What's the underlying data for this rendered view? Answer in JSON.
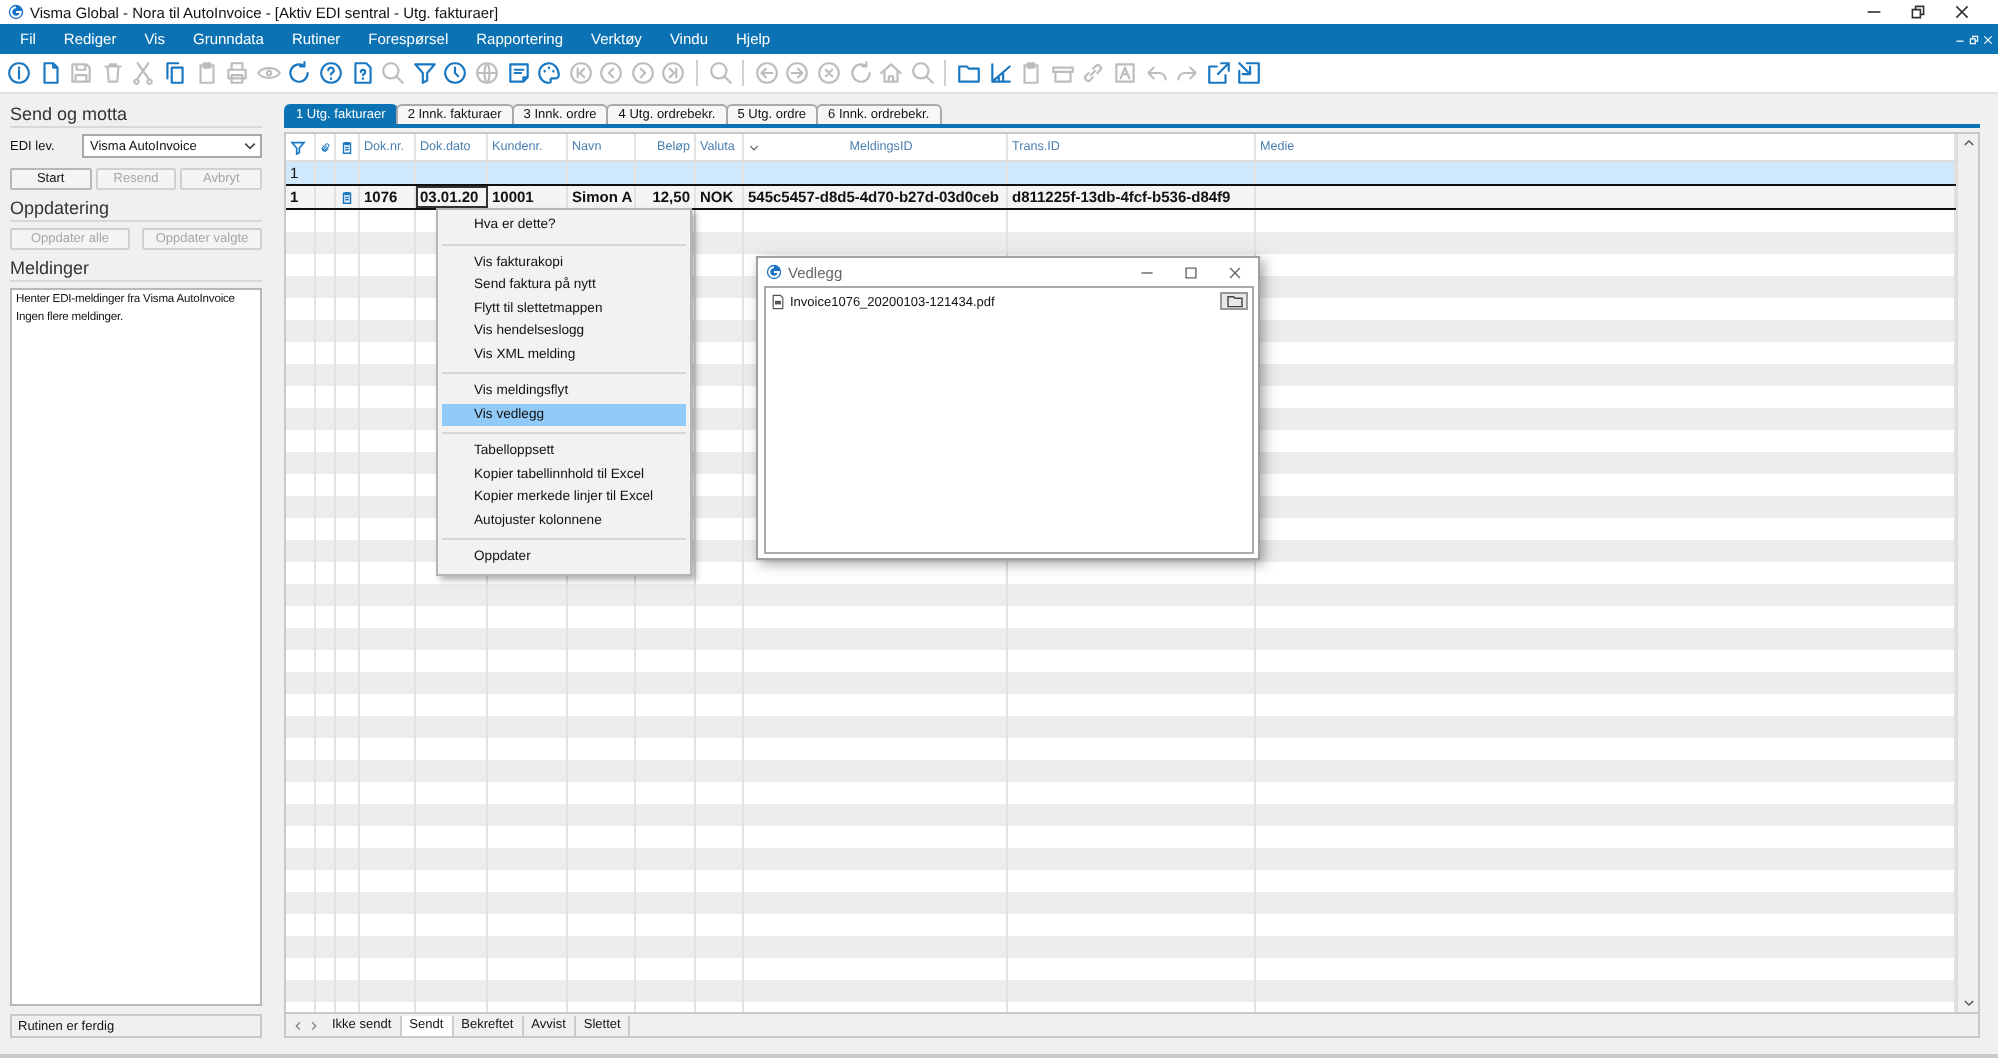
{
  "window": {
    "title": "Visma Global - Nora til AutoInvoice - [Aktiv EDI sentral - Utg. fakturaer]"
  },
  "menu": [
    "Fil",
    "Rediger",
    "Vis",
    "Grunndata",
    "Rutiner",
    "Forespørsel",
    "Rapportering",
    "Verktøy",
    "Vindu",
    "Hjelp"
  ],
  "toolbar": [
    {
      "kind": "info",
      "disabled": false
    },
    {
      "kind": "new",
      "disabled": false
    },
    {
      "kind": "save",
      "disabled": true
    },
    {
      "kind": "delete",
      "disabled": true
    },
    {
      "kind": "cut",
      "disabled": true
    },
    {
      "kind": "copy",
      "disabled": false
    },
    {
      "kind": "paste",
      "disabled": true
    },
    {
      "kind": "print",
      "disabled": true
    },
    {
      "kind": "eye",
      "disabled": true
    },
    {
      "kind": "refresh",
      "disabled": false
    },
    {
      "kind": "help",
      "disabled": false
    },
    {
      "kind": "dochelp",
      "disabled": false
    },
    {
      "kind": "search",
      "disabled": true
    },
    {
      "kind": "filter",
      "disabled": false
    },
    {
      "kind": "clock",
      "disabled": false
    },
    {
      "kind": "globe",
      "disabled": true
    },
    {
      "kind": "note",
      "disabled": false
    },
    {
      "kind": "palette",
      "disabled": false
    },
    {
      "kind": "first",
      "disabled": true
    },
    {
      "kind": "prev",
      "disabled": true
    },
    {
      "kind": "next",
      "disabled": true
    },
    {
      "kind": "last",
      "disabled": true
    },
    {
      "kind": "separator"
    },
    {
      "kind": "search",
      "disabled": true
    },
    {
      "kind": "separator"
    },
    {
      "kind": "back",
      "disabled": true
    },
    {
      "kind": "forward",
      "disabled": true
    },
    {
      "kind": "cancel",
      "disabled": true
    },
    {
      "kind": "refresh",
      "disabled": true
    },
    {
      "kind": "home",
      "disabled": true
    },
    {
      "kind": "search",
      "disabled": true
    },
    {
      "kind": "separator"
    },
    {
      "kind": "folder",
      "disabled": false
    },
    {
      "kind": "chart",
      "disabled": false
    },
    {
      "kind": "paste",
      "disabled": true
    },
    {
      "kind": "box",
      "disabled": true
    },
    {
      "kind": "link",
      "disabled": true
    },
    {
      "kind": "textbox",
      "disabled": true
    },
    {
      "kind": "undo",
      "disabled": true
    },
    {
      "kind": "redo",
      "disabled": true
    },
    {
      "kind": "export",
      "disabled": false
    },
    {
      "kind": "import",
      "disabled": false
    }
  ],
  "left_panel": {
    "send_title": "Send og motta",
    "edi_label": "EDI lev.",
    "edi_value": "Visma AutoInvoice",
    "send_buttons": [
      {
        "label": "Start",
        "disabled": false
      },
      {
        "label": "Resend",
        "disabled": true
      },
      {
        "label": "Avbryt",
        "disabled": true
      }
    ],
    "update_title": "Oppdatering",
    "update_buttons": [
      {
        "label": "Oppdater alle",
        "disabled": true
      },
      {
        "label": "Oppdater valgte",
        "disabled": true
      }
    ],
    "messages_title": "Meldinger",
    "messages": [
      "Henter EDI-meldinger fra Visma AutoInvoice",
      "Ingen flere meldinger."
    ],
    "status": "Rutinen er ferdig"
  },
  "tabs": [
    {
      "label": "1 Utg. fakturaer",
      "selected": true
    },
    {
      "label": "2 Innk. fakturaer",
      "selected": false
    },
    {
      "label": "3 Innk. ordre",
      "selected": false
    },
    {
      "label": "4 Utg. ordrebekr.",
      "selected": false
    },
    {
      "label": "5 Utg. ordre",
      "selected": false
    },
    {
      "label": "6 Innk. ordrebekr.",
      "selected": false
    }
  ],
  "table": {
    "columns": [
      "Dok.nr.",
      "Dok.dato",
      "Kundenr.",
      "Navn",
      "Beløp",
      "Valuta",
      "MeldingsID",
      "Trans.ID",
      "Medie"
    ],
    "rows": [
      {
        "number": "1",
        "selected": true,
        "current": false,
        "document": false
      },
      {
        "number": "1",
        "selected": false,
        "current": true,
        "document": true,
        "cells": [
          "1076",
          "03.01.20",
          "10001",
          "Simon A",
          "12,50",
          "NOK",
          "545c5457-d8d5-4d70-b27d-03d0ceb",
          "d811225f-13db-4fcf-b536-d84f9"
        ]
      }
    ]
  },
  "context_menu": [
    {
      "kind": "item",
      "label": "Hva er dette?",
      "selected": false
    },
    {
      "kind": "separator"
    },
    {
      "kind": "item",
      "label": "Vis fakturakopi",
      "selected": false
    },
    {
      "kind": "item",
      "label": "Send faktura på nytt",
      "selected": false
    },
    {
      "kind": "item",
      "label": "Flytt til slettetmappen",
      "selected": false
    },
    {
      "kind": "item",
      "label": "Vis hendelseslogg",
      "selected": false
    },
    {
      "kind": "item",
      "label": "Vis XML melding",
      "selected": false
    },
    {
      "kind": "separator"
    },
    {
      "kind": "item",
      "label": "Vis meldingsflyt",
      "selected": false
    },
    {
      "kind": "item",
      "label": "Vis vedlegg",
      "selected": true
    },
    {
      "kind": "separator"
    },
    {
      "kind": "item",
      "label": "Tabelloppsett",
      "selected": false
    },
    {
      "kind": "item",
      "label": "Kopier tabellinnhold til Excel",
      "selected": false
    },
    {
      "kind": "item",
      "label": "Kopier merkede linjer til Excel",
      "selected": false
    },
    {
      "kind": "item",
      "label": "Autojuster kolonnene",
      "selected": false
    },
    {
      "kind": "separator"
    },
    {
      "kind": "item",
      "label": "Oppdater",
      "selected": false
    }
  ],
  "dialog": {
    "title": "Vedlegg",
    "files": [
      "Invoice1076_20200103-121434.pdf"
    ]
  },
  "status_tabs": [
    {
      "label": "Ikke sendt",
      "selected": false
    },
    {
      "label": "Sendt",
      "selected": true
    },
    {
      "label": "Bekreftet",
      "selected": false
    },
    {
      "label": "Avvist",
      "selected": false
    },
    {
      "label": "Slettet",
      "selected": false
    }
  ]
}
